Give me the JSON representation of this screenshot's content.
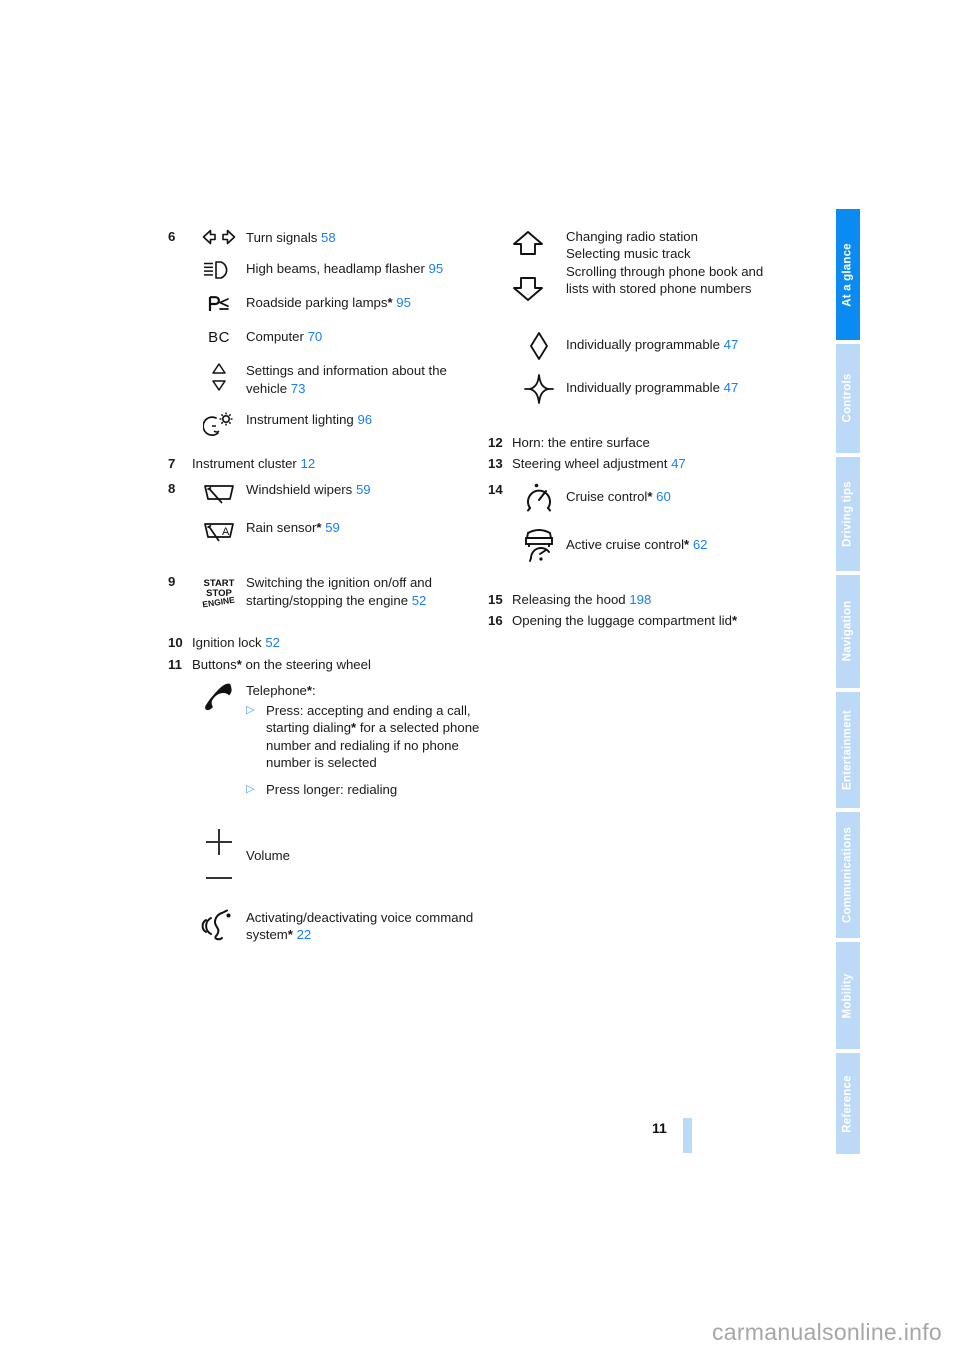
{
  "page": {
    "folio": "11",
    "watermark": "carmanualsonline.info"
  },
  "colors": {
    "link": "#1a7ff0",
    "tab_active": "#0b8bf2",
    "tab_inactive": "#bcd9f8",
    "tab_label": "#ffffff"
  },
  "tabs": [
    {
      "label": "At a glance",
      "active": true
    },
    {
      "label": "Controls",
      "active": false
    },
    {
      "label": "Driving tips",
      "active": false
    },
    {
      "label": "Navigation",
      "active": false
    },
    {
      "label": "Entertainment",
      "active": false
    },
    {
      "label": "Communications",
      "active": false
    },
    {
      "label": "Mobility",
      "active": false
    },
    {
      "label": "Reference",
      "active": false
    }
  ],
  "left_column": {
    "item6": {
      "number": "6",
      "rows": [
        {
          "icon": "turn-signals-icon",
          "label": "Turn signals",
          "star": "",
          "page": "58"
        },
        {
          "icon": "high-beam-icon",
          "label": "High beams, headlamp flasher",
          "star": "",
          "page": "95"
        },
        {
          "icon": "roadside-parking-lamps-icon",
          "label": "Roadside parking lamps",
          "star": "*",
          "page": "95"
        },
        {
          "icon": "onboard-computer-icon",
          "label": "Computer",
          "star": "",
          "page": "70"
        },
        {
          "icon": "up-down-triangles-icon",
          "label": "Settings and information about the vehicle",
          "star": "",
          "page": "73"
        },
        {
          "icon": "instrument-lighting-icon",
          "label": "Instrument lighting",
          "star": "",
          "page": "96"
        }
      ]
    },
    "item7": {
      "number": "7",
      "label": "Instrument cluster",
      "page": "12"
    },
    "item8": {
      "number": "8",
      "rows": [
        {
          "icon": "windshield-wiper-icon",
          "label": "Windshield wipers",
          "star": "",
          "page": "59"
        },
        {
          "icon": "rain-sensor-icon",
          "label": "Rain sensor",
          "star": "*",
          "page": "59"
        }
      ]
    },
    "item9": {
      "number": "9",
      "icon": "start-stop-engine-icon",
      "label": "Switching the ignition on/off and starting/stopping the engine",
      "page": "52"
    },
    "item10": {
      "number": "10",
      "label": "Ignition lock",
      "page": "52"
    },
    "item11": {
      "number": "11",
      "label_pre": "Buttons",
      "star": "*",
      "label_post": " on the steering wheel",
      "telephone": {
        "icon": "telephone-handset-icon",
        "label": "Telephone",
        "star": "*",
        "colon": ":",
        "bullets": [
          {
            "marker": "▷",
            "text_pre": "Press: accepting and ending a call, starting dialing",
            "star": "*",
            "text_post": " for a selected phone number and redialing if no phone number is selected"
          },
          {
            "marker": "▷",
            "text_pre": "Press longer: redialing",
            "star": "",
            "text_post": ""
          }
        ]
      },
      "volume": {
        "icon": "volume-plus-minus-icon",
        "label": "Volume"
      },
      "voice": {
        "icon": "voice-command-icon",
        "label": "Activating/deactivating voice command system",
        "star": "*",
        "page": "22"
      }
    }
  },
  "right_column": {
    "scroll_block": {
      "icon_up": "arrow-up-icon",
      "icon_down": "arrow-down-icon",
      "lines": [
        "Changing radio station",
        "Selecting music track",
        "Scrolling through phone book and",
        "lists with stored phone numbers"
      ]
    },
    "programmable_rows": [
      {
        "icon": "diamond-icon",
        "label": "Individually programmable",
        "page": "47"
      },
      {
        "icon": "four-point-star-icon",
        "label": "Individually programmable",
        "page": "47"
      }
    ],
    "item12": {
      "number": "12",
      "label": "Horn: the entire surface",
      "page": ""
    },
    "item13": {
      "number": "13",
      "label": "Steering wheel adjustment",
      "page": "47"
    },
    "item14": {
      "number": "14",
      "rows": [
        {
          "icon": "cruise-control-icon",
          "label": "Cruise control",
          "star": "*",
          "page": "60"
        },
        {
          "icon": "active-cruise-control-icon",
          "label": "Active cruise control",
          "star": "*",
          "page": "62"
        }
      ]
    },
    "item15": {
      "number": "15",
      "label": "Releasing the hood",
      "page": "198"
    },
    "item16": {
      "number": "16",
      "label_pre": "Opening the luggage compartment lid",
      "star": "*"
    }
  }
}
